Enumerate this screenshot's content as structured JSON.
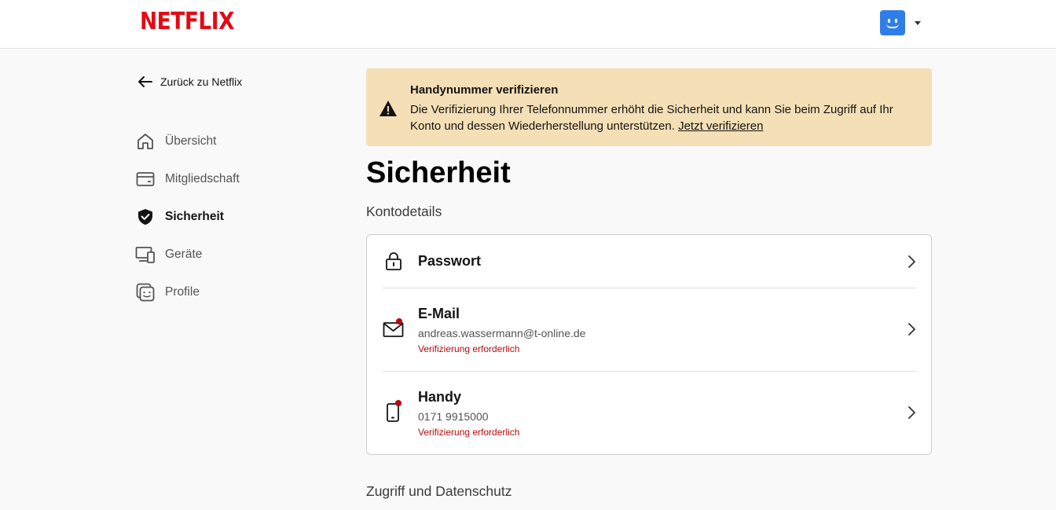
{
  "header": {
    "logo": "NETFLIX",
    "avatar_icon": "profile-avatar-smile",
    "menu_icon": "caret-down-icon"
  },
  "sidebar": {
    "back_label": "Zurück zu Netflix",
    "items": [
      {
        "label": "Übersicht",
        "icon": "home-icon"
      },
      {
        "label": "Mitgliedschaft",
        "icon": "card-icon"
      },
      {
        "label": "Sicherheit",
        "icon": "shield-check-icon",
        "active": true
      },
      {
        "label": "Geräte",
        "icon": "devices-icon"
      },
      {
        "label": "Profile",
        "icon": "profiles-icon"
      }
    ]
  },
  "banner": {
    "title": "Handynummer verifizieren",
    "text": "Die Verifizierung Ihrer Telefonnummer erhöht die Sicherheit und kann Sie beim Zugriff auf Ihr Konto und dessen Wiederherstellung unterstützen.",
    "link": "Jetzt verifizieren"
  },
  "main": {
    "title": "Sicherheit",
    "account_section": "Kontodetails",
    "rows": [
      {
        "title": "Passwort",
        "icon": "lock-icon"
      },
      {
        "title": "E-Mail",
        "value": "andreas.wassermann@t-online.de",
        "warning": "Verifizierung erforderlich",
        "icon": "mail-icon"
      },
      {
        "title": "Handy",
        "value": "0171 9915000",
        "warning": "Verifizierung erforderlich",
        "icon": "phone-icon"
      }
    ],
    "privacy_section": "Zugriff und Datenschutz"
  },
  "colors": {
    "brand": "#e50914",
    "banner_bg": "#f5dfb6",
    "warning_text": "#b9090b",
    "avatar": "#2f7ee8"
  }
}
